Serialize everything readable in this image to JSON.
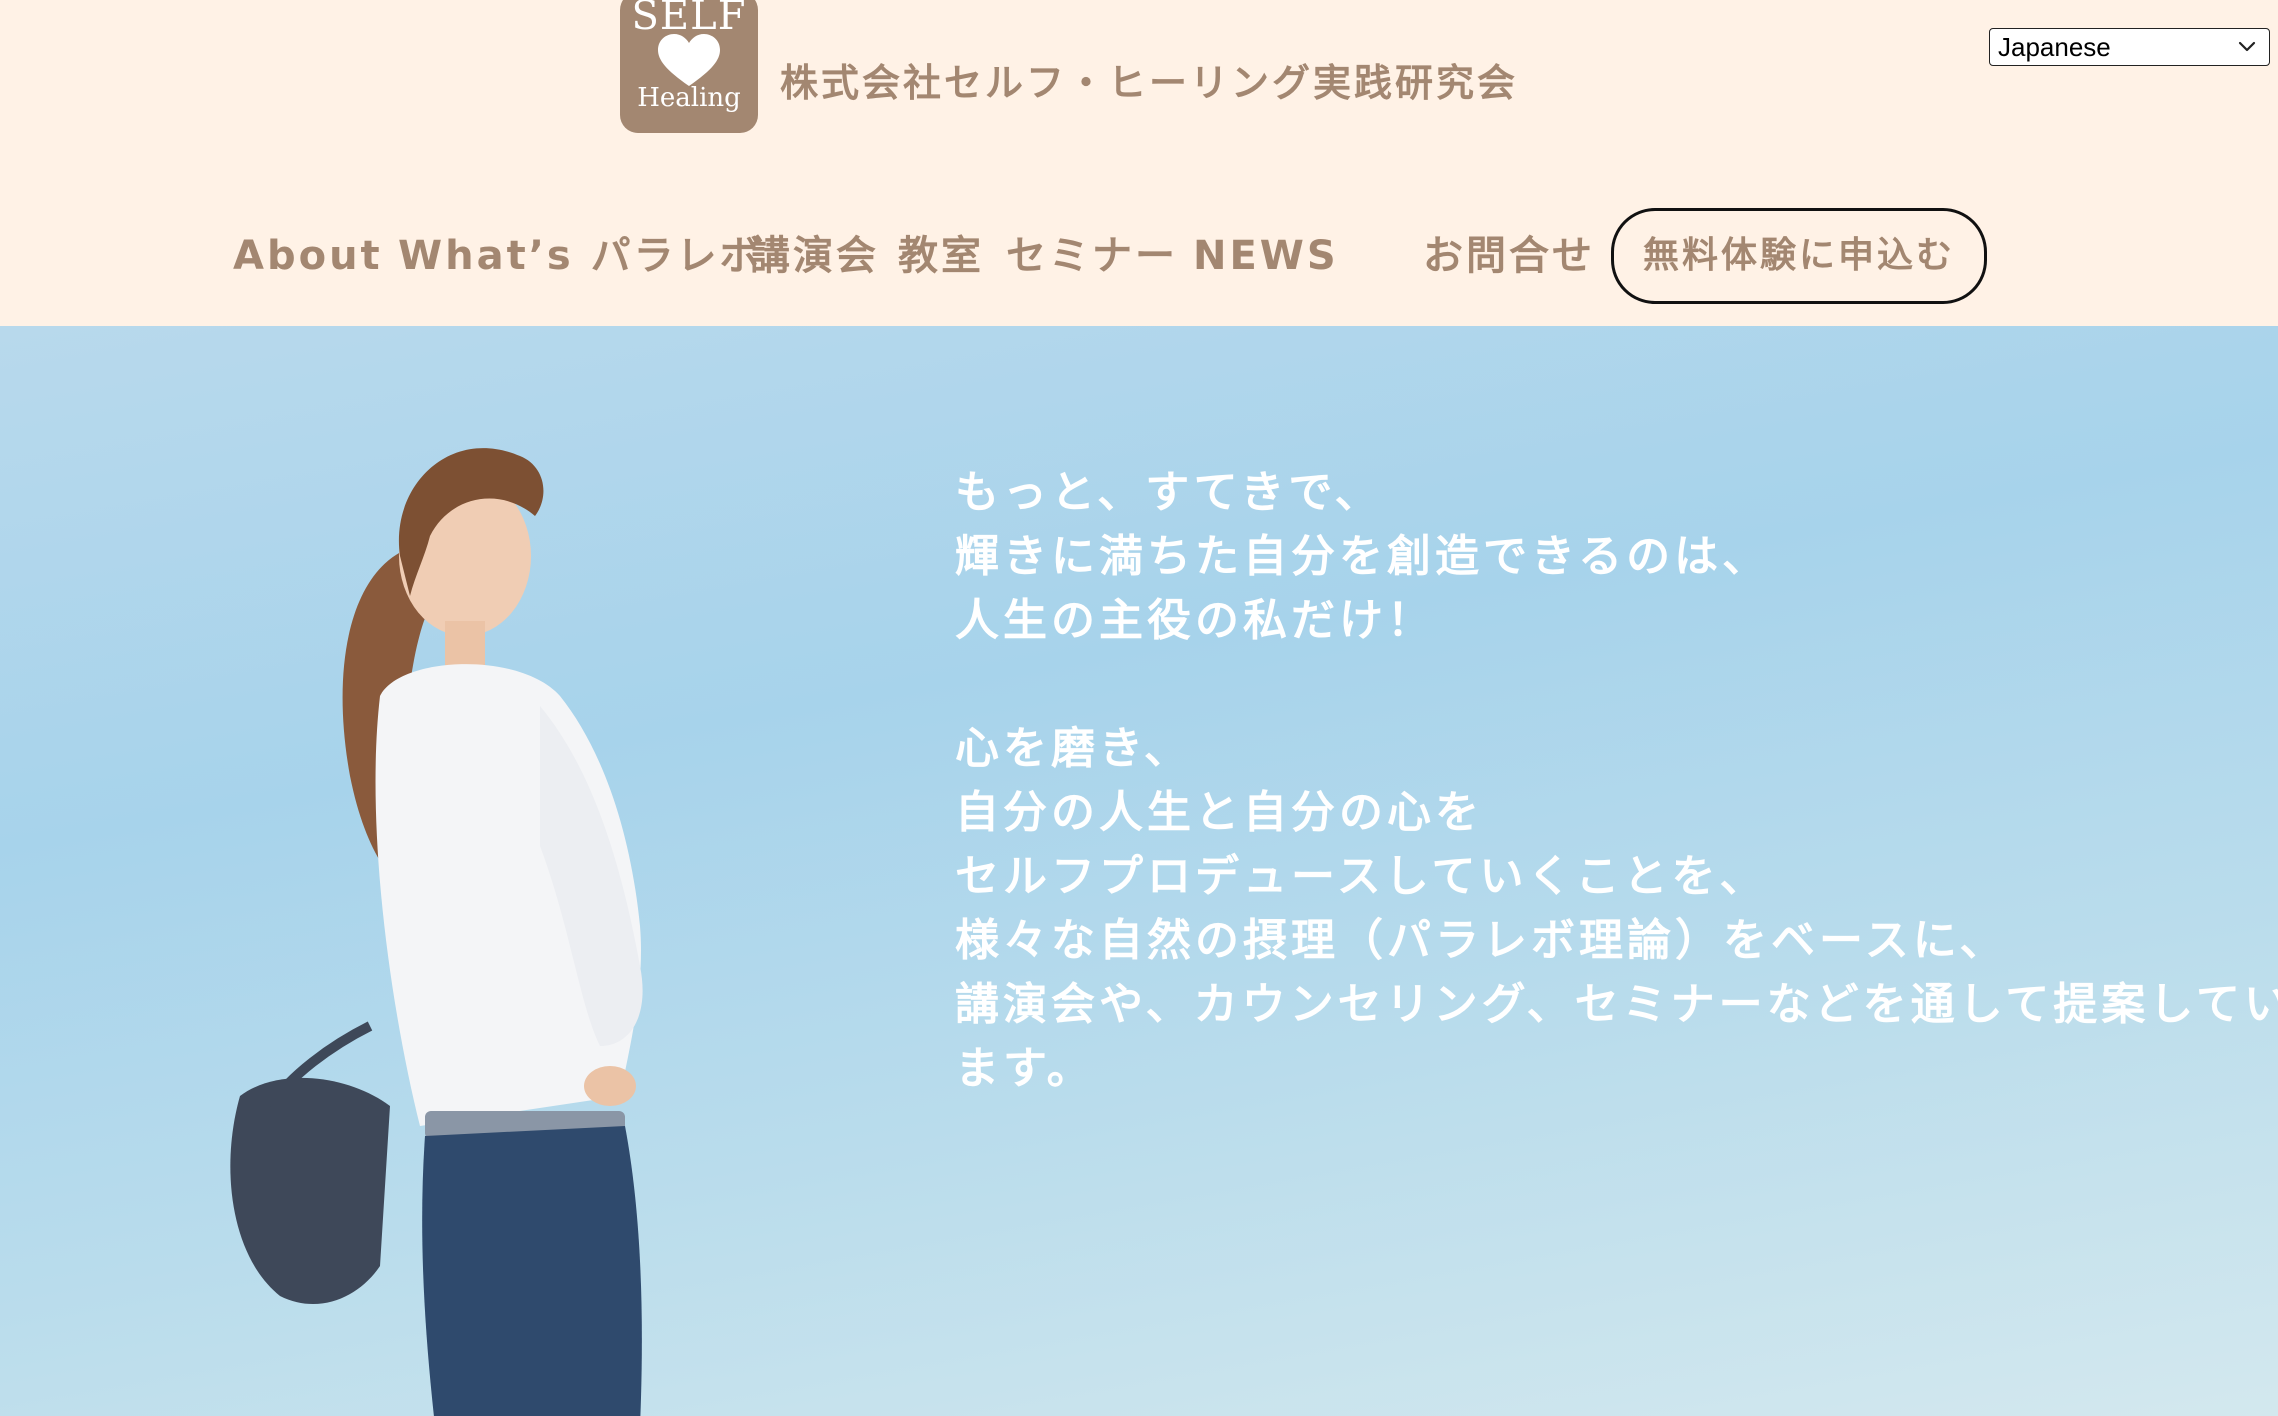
{
  "header": {
    "logo": {
      "top_text": "SELF",
      "bottom_text": "Healing",
      "icon": "heart-icon"
    },
    "company_name": "株式会社セルフ・ヒーリング実践研究会",
    "language_select": {
      "value": "Japanese",
      "icon": "chevron-down-icon"
    }
  },
  "nav": {
    "items": [
      {
        "label": "About"
      },
      {
        "label": "What’s パラレボ"
      },
      {
        "label": "講演会"
      },
      {
        "label": "教室"
      },
      {
        "label": "セミナー"
      },
      {
        "label": "NEWS"
      },
      {
        "label": "お問合せ"
      }
    ],
    "cta_label": "無料体験に申込む"
  },
  "hero": {
    "paragraph1": [
      "もっと、すてきで、",
      "輝きに満ちた自分を創造できるのは、",
      "人生の主役の私だけ！"
    ],
    "paragraph2": [
      "心を磨き、",
      "自分の人生と自分の心を",
      "セルフプロデュースしていくことを、",
      "様々な自然の摂理（パラレボ理論）をベースに、",
      "講演会や、カウンセリング、セミナーなどを通して提案してい",
      "ます。"
    ]
  },
  "colors": {
    "header_bg": "#fff2e6",
    "brand": "#a38771",
    "hero_sky": "#a7d3eb",
    "hero_text": "#ffffff"
  }
}
